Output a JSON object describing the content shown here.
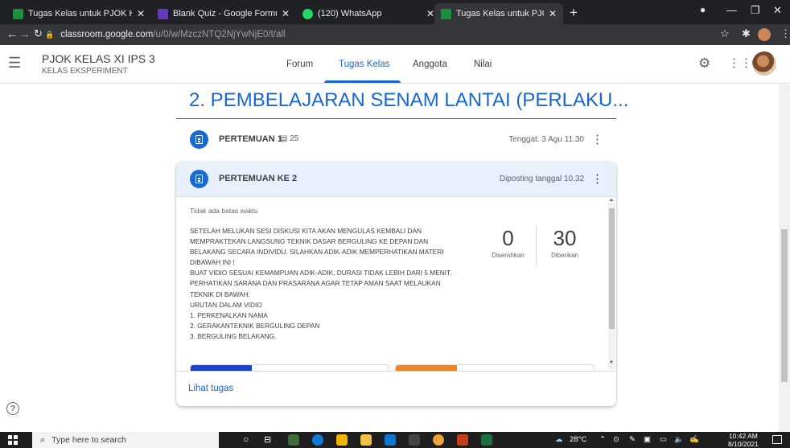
{
  "browser": {
    "tabs": [
      {
        "title": "Tugas Kelas untuk PJOK KELAS XI",
        "favicon_color": "#1e8e3e",
        "active": false
      },
      {
        "title": "Blank Quiz - Google Formulir",
        "favicon_color": "#673ab7",
        "active": false
      },
      {
        "title": "(120) WhatsApp",
        "favicon_color": "#25d366",
        "active": false
      },
      {
        "title": "Tugas Kelas untuk PJOK KELAS XI",
        "favicon_color": "#1e8e3e",
        "active": true
      }
    ],
    "url_host": "classroom.google.com",
    "url_path": "/u/0/w/MzczNTQ2NjYwNjE0/t/all"
  },
  "appbar": {
    "class_name": "PJOK KELAS XI IPS 3",
    "class_section": "KELAS EKSPERIMENT",
    "tabs": [
      {
        "label": "Forum",
        "active": false
      },
      {
        "label": "Tugas Kelas",
        "active": true
      },
      {
        "label": "Anggota",
        "active": false
      },
      {
        "label": "Nilai",
        "active": false
      }
    ]
  },
  "topic": {
    "title": "2. PEMBELAJARAN SENAM LANTAI (PERLAKU..."
  },
  "assignments": [
    {
      "title": "PERTEMUAN 1",
      "comment_count": "25",
      "date_label": "Tenggat: 3 Agu 11.30"
    },
    {
      "title": "PERTEMUAN KE 2",
      "date_label": "Diposting tanggal 10.32"
    }
  ],
  "card": {
    "due_label": "Tidak ada batas waktu",
    "description_lines": [
      "SETELAH MELUKAN SESI DISKUSI KITA AKAN MENGULAS KEMBALI DAN",
      "MEMPRAKTEKAN LANGSUNG TEKNIK DASAR BERGULING KE DEPAN DAN",
      "BELAKANG SECARA INDIVIDU. SILAHKAN ADIK-ADIK MEMPERHATIKAN MATERI",
      "DIBAWAH INI !",
      "BUAT VIDIO SESUAI KEMAMPUAN ADIK-ADIK, DURASI TIDAK LEBIH DARI 5 MENIT.",
      "PERHATIKAN SARANA DAN PRASARANA AGAR TETAP AMAN SAAT MELAUKAN",
      "TEKNIK DI BAWAH.",
      "URUTAN DALAM VIDIO",
      "1. PERKENALKAN NAMA",
      "2. GERAKANTEKNIK BERGULING DEPAN",
      "3. BERGULING BELAKANG."
    ],
    "turned_in": {
      "count": "0",
      "label": "Diserahkan"
    },
    "assigned": {
      "count": "30",
      "label": "Diberikan"
    },
    "view_link": "Lihat tugas"
  },
  "taskbar": {
    "search_placeholder": "Type here to search",
    "weather": "28°C",
    "time": "10:42 AM",
    "date": "8/10/2021"
  }
}
